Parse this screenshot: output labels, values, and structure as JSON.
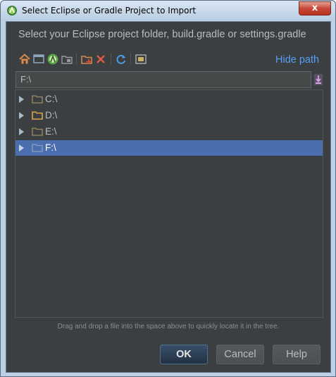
{
  "window": {
    "title": "Select Eclipse or Gradle Project to Import",
    "close_glyph": "x"
  },
  "dialog": {
    "prompt": "Select your Eclipse project folder, build.gradle or settings.gradle",
    "hide_path_label": "Hide path",
    "path_value": "F:\\",
    "hint": "Drag and drop a file into the space above to quickly locate it in the tree."
  },
  "toolbar": [
    {
      "name": "home-directory",
      "icon": "home-icon"
    },
    {
      "name": "desktop",
      "icon": "desktop-icon"
    },
    {
      "name": "project-directory",
      "icon": "android-studio-icon"
    },
    {
      "name": "module-directory",
      "icon": "module-folder-icon"
    },
    {
      "name": "new-folder",
      "icon": "new-folder-icon"
    },
    {
      "name": "delete",
      "icon": "delete-icon"
    },
    {
      "name": "refresh",
      "icon": "refresh-icon"
    },
    {
      "name": "show-hidden",
      "icon": "show-hidden-files-icon"
    }
  ],
  "tree": {
    "items": [
      {
        "label": "C:\\",
        "selected": false
      },
      {
        "label": "D:\\",
        "selected": false
      },
      {
        "label": "E:\\",
        "selected": false
      },
      {
        "label": "F:\\",
        "selected": true
      }
    ]
  },
  "buttons": {
    "ok": "OK",
    "cancel": "Cancel",
    "help": "Help"
  },
  "colors": {
    "background": "#3c3f41",
    "selection": "#4b6eaf",
    "link": "#589df6",
    "text": "#bbbbbb"
  }
}
